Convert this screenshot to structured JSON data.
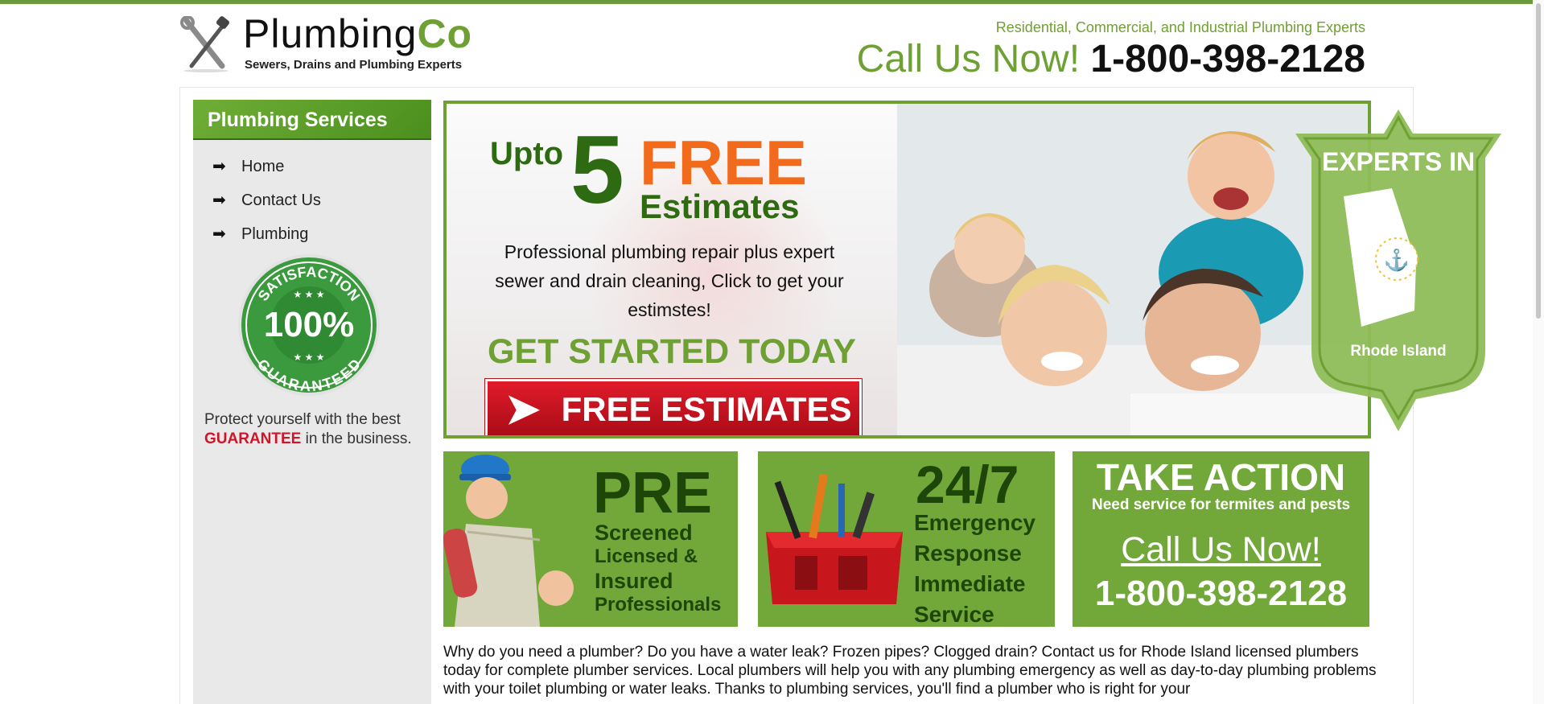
{
  "header": {
    "logo_word": "Plumbing",
    "logo_word_accent": "Co",
    "logo_tagline": "Sewers, Drains and Plumbing Experts",
    "tagline": "Residential, Commercial, and Industrial Plumbing Experts",
    "call_label": "Call Us Now!",
    "phone": "1-800-398-2128"
  },
  "sidebar": {
    "title": "Plumbing Services",
    "items": [
      {
        "label": "Home"
      },
      {
        "label": "Contact Us"
      },
      {
        "label": "Plumbing"
      }
    ],
    "seal_top": "SATISFACTION",
    "seal_center": "100%",
    "seal_bottom": "GUARANTEED",
    "guarantee_pre": "Protect yourself with the best",
    "guarantee_strong": "GUARANTEE",
    "guarantee_post": "in the business."
  },
  "hero": {
    "upto": "Upto",
    "number": "5",
    "free": "FREE",
    "estimates": "Estimates",
    "copy": "Professional plumbing repair plus expert sewer and drain cleaning, Click to get your estimstes!",
    "get_started": "GET STARTED TODAY",
    "button": "FREE ESTIMATES"
  },
  "badge": {
    "title": "EXPERTS IN",
    "state": "Rhode Island"
  },
  "promos": {
    "pre": {
      "big": "PRE",
      "line1": "Screened",
      "line2": "Licensed &",
      "line3": "Insured",
      "line4": "Professionals"
    },
    "emergency": {
      "big": "24/7",
      "line1": "Emergency",
      "line2": "Response",
      "line3": "Immediate",
      "line4": "Service"
    },
    "action": {
      "title": "TAKE ACTION",
      "subtitle": "Need service for termites and pests",
      "call": "Call Us Now!",
      "phone": "1-800-398-2128"
    }
  },
  "body_text": "Why do you need a plumber? Do you have a water leak? Frozen pipes? Clogged drain? Contact us for Rhode Island licensed plumbers today for complete plumber services. Local plumbers will help you with any plumbing emergency as well as day-to-day plumbing problems with your toilet plumbing or water leaks. Thanks to plumbing services, you'll find a plumber who is right for your",
  "colors": {
    "brand_green": "#6fa033",
    "dark_green": "#2d6a12",
    "orange": "#f26b1d",
    "red": "#d0152a"
  }
}
